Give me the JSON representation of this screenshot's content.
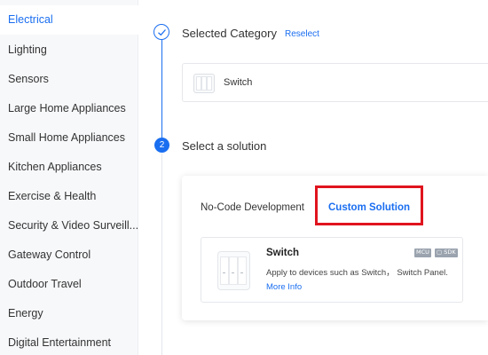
{
  "sidebar": {
    "items": [
      {
        "label": "Electrical"
      },
      {
        "label": "Lighting"
      },
      {
        "label": "Sensors"
      },
      {
        "label": "Large Home Appliances"
      },
      {
        "label": "Small Home Appliances"
      },
      {
        "label": "Kitchen Appliances"
      },
      {
        "label": "Exercise & Health"
      },
      {
        "label": "Security & Video Surveill..."
      },
      {
        "label": "Gateway Control"
      },
      {
        "label": "Outdoor Travel"
      },
      {
        "label": "Energy"
      },
      {
        "label": "Digital Entertainment"
      }
    ],
    "active_index": 0
  },
  "step1": {
    "title": "Selected Category",
    "reselect_label": "Reselect",
    "selected_item": "Switch",
    "icon": "check-icon"
  },
  "step2": {
    "number": "2",
    "title": "Select a solution",
    "tabs": [
      {
        "label": "No-Code Development"
      },
      {
        "label": "Custom Solution",
        "active": true
      }
    ],
    "card": {
      "title": "Switch",
      "description": "Apply to devices such as Switch， Switch Panel.",
      "link": "More Info",
      "badges": [
        "MCU",
        "▢ SDK"
      ]
    }
  },
  "colors": {
    "accent": "#1a6ef0",
    "highlight": "#e0141e",
    "sidebar_bg": "#f7f8fa"
  }
}
